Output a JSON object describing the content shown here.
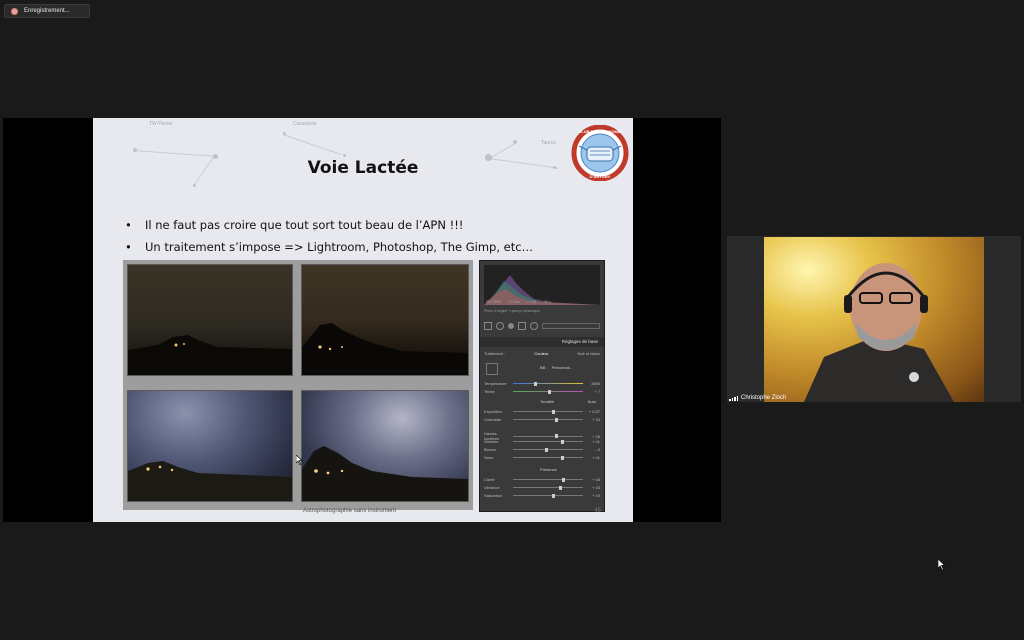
{
  "recording": {
    "label": "Enregistrement..."
  },
  "slide": {
    "title": "Voie Lactée",
    "bullets": [
      "Il ne faut pas croire que tout sort tout beau de l’APN !!!",
      "Un traitement s’impose => Lightroom, Photoshop, The Gimp, etc…"
    ],
    "footer": "Astrophotographie sans instrument",
    "page_number": "45",
    "logo": {
      "top_text": "CLUB D'ASTRONOMIE",
      "bottom_text": "D'ANTONY"
    },
    "sky_labels": [
      "TW-Persei",
      "Cassiopée",
      "Taurus"
    ]
  },
  "lightroom": {
    "header": "Réglages de base",
    "tabs": [
      "Traitement :",
      "Couleur",
      "Noir et blanc"
    ],
    "wb_label": "BB :",
    "wb_value": "Personnal...",
    "rows_top": [
      {
        "label": "Température",
        "value": "3650"
      },
      {
        "label": "Teinte",
        "value": "+ 7"
      }
    ],
    "tone_header": "Tonalité",
    "tone_auto": "Auto",
    "rows_tone": [
      {
        "label": "Exposition",
        "value": "+ 0,57"
      },
      {
        "label": "Contraste",
        "value": "+ 33"
      }
    ],
    "rows_light": [
      {
        "label": "Hautes lumières",
        "value": "+ 26"
      },
      {
        "label": "Ombres",
        "value": "+ 41"
      },
      {
        "label": "Blancs",
        "value": "– 9"
      },
      {
        "label": "Noirs",
        "value": "+ 41"
      }
    ],
    "presence_header": "Présence",
    "rows_presence": [
      {
        "label": "Clarté",
        "value": "+ 48"
      },
      {
        "label": "Vibrance",
        "value": "+ 33"
      },
      {
        "label": "Saturation",
        "value": "+ 10"
      }
    ],
    "hist_info": [
      "ISO 3200",
      "17 mm",
      "f / 2,8",
      "20 s"
    ],
    "preview_note": "Photo d'origine + aperçu dynamique"
  },
  "participant": {
    "name": "Christophe Zloch"
  }
}
